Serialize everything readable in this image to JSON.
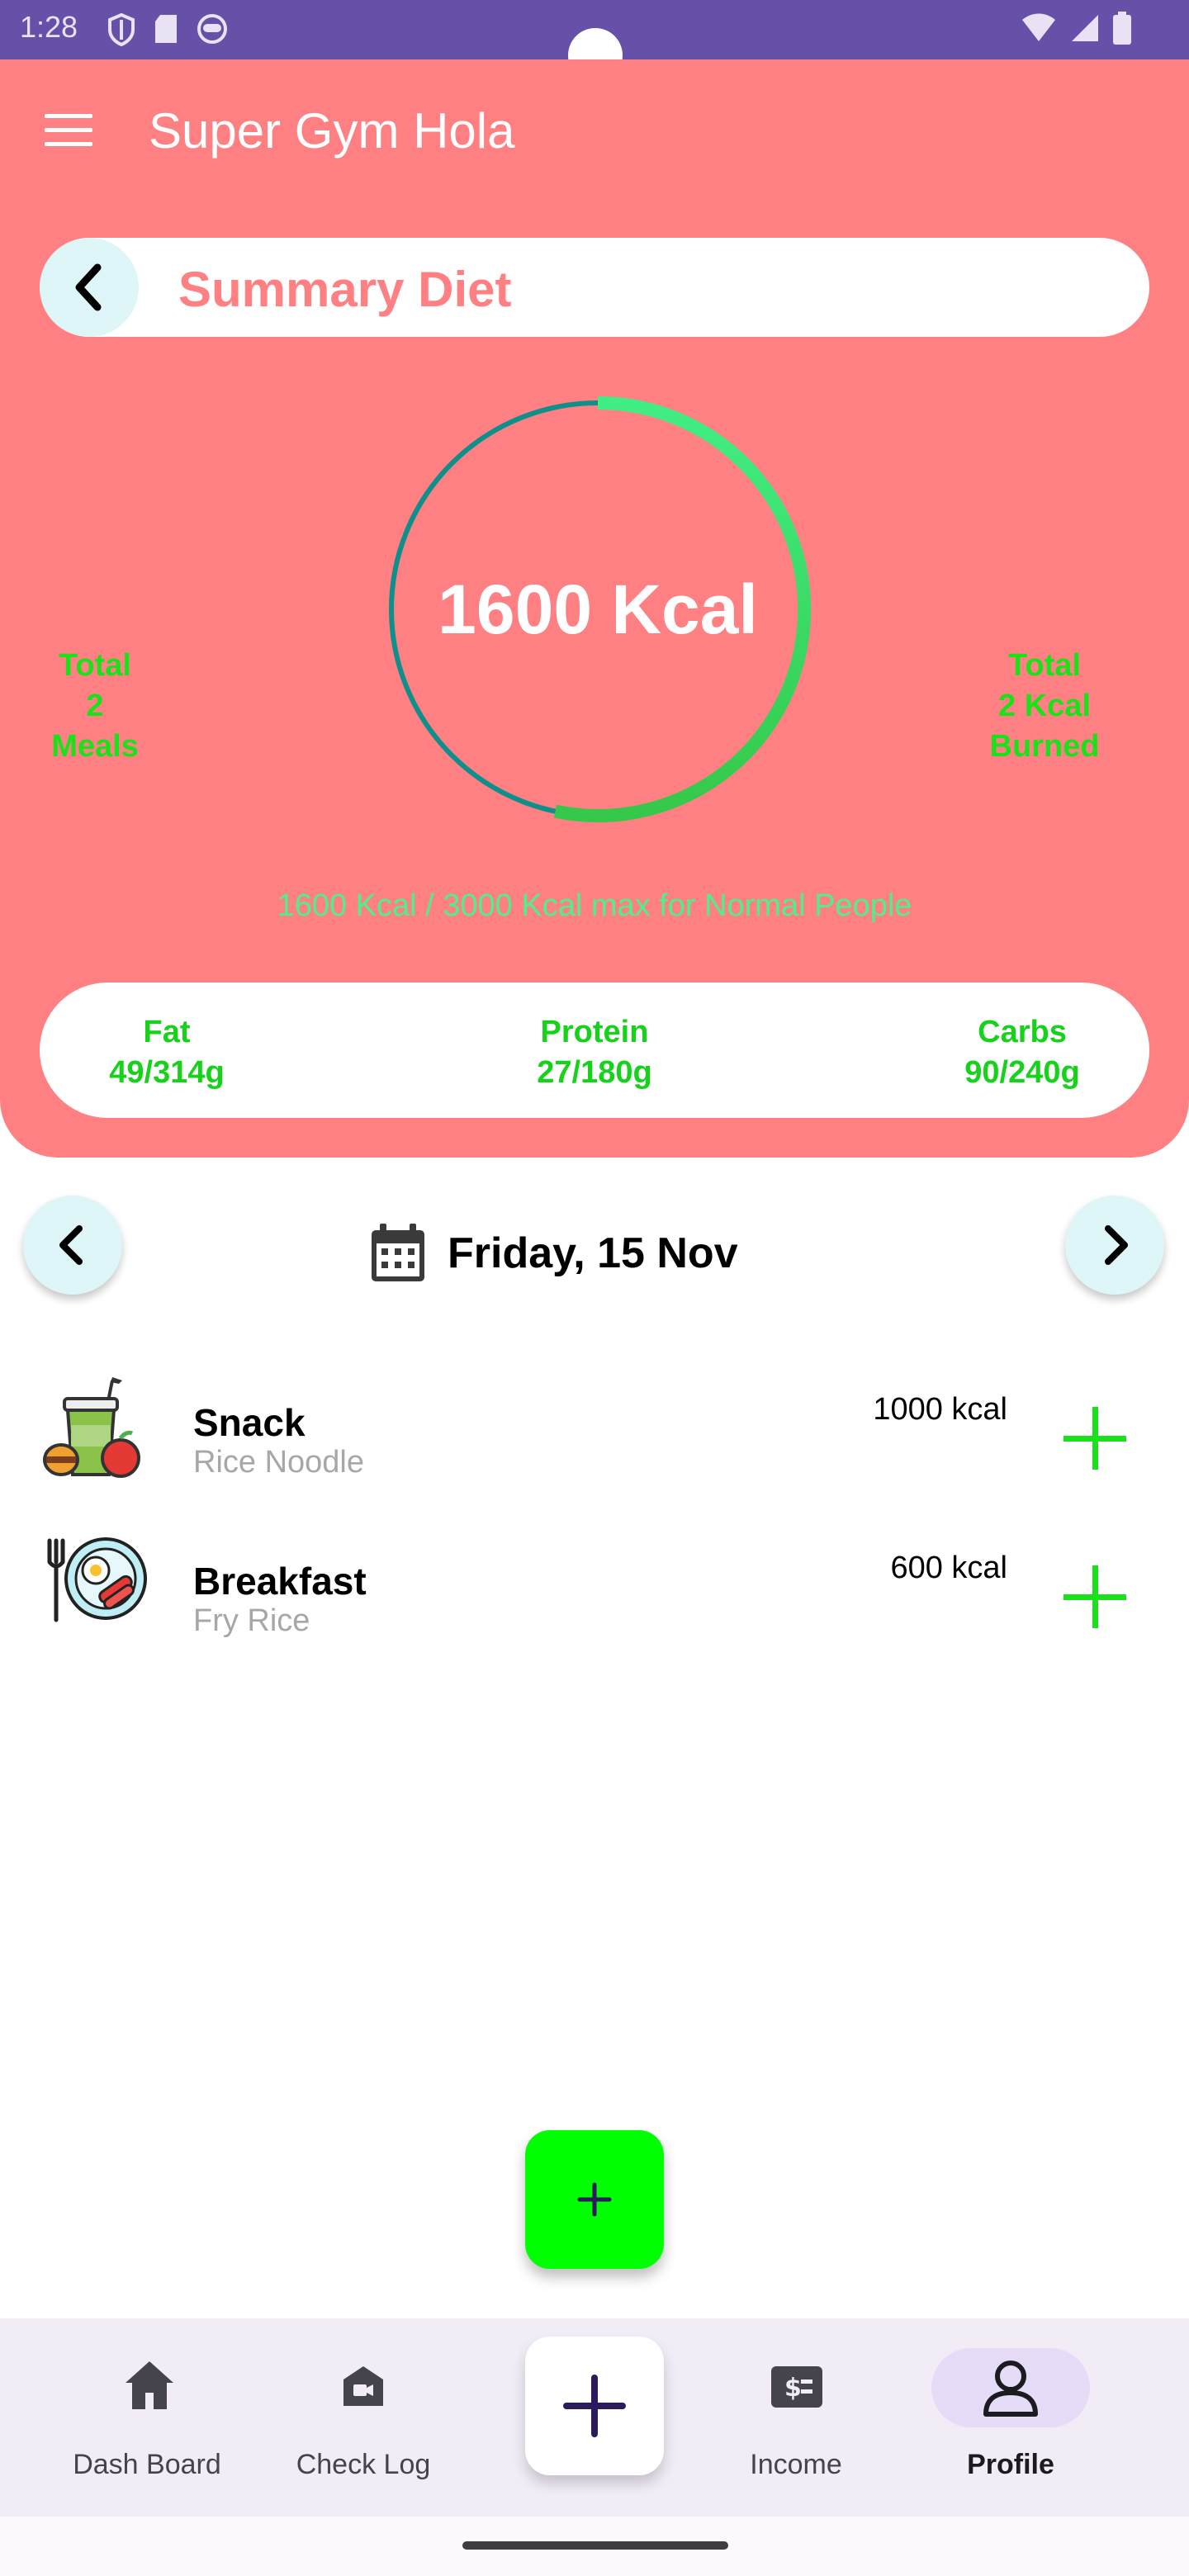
{
  "status_bar": {
    "time": "1:28",
    "left_icons": [
      "shield-icon",
      "sd-card-icon",
      "face-icon"
    ],
    "right_icons": [
      "wifi-icon",
      "signal-icon",
      "battery-icon"
    ]
  },
  "app_bar": {
    "title": "Super Gym Hola",
    "menu_icon": "hamburger-menu-icon"
  },
  "summary": {
    "title": "Summary Diet",
    "back_icon": "chevron-left-icon",
    "calories_label": "1600 Kcal",
    "calories_consumed": 1600,
    "calories_max": 3000,
    "progress_fraction": 0.533,
    "left_stat": [
      "Total",
      "2",
      "Meals"
    ],
    "right_stat": [
      "Total",
      "2 Kcal",
      "Burned"
    ],
    "max_note": "1600 Kcal / 3000 Kcal max for Normal People",
    "macros": [
      {
        "name": "Fat",
        "value": "49/314g"
      },
      {
        "name": "Protein",
        "value": "27/180g"
      },
      {
        "name": "Carbs",
        "value": "90/240g"
      }
    ]
  },
  "date_nav": {
    "date": "Friday, 15 Nov",
    "prev_icon": "chevron-left-icon",
    "next_icon": "chevron-right-icon",
    "calendar_icon": "calendar-icon"
  },
  "meals": [
    {
      "name": "Snack",
      "food": "Rice Noodle",
      "kcal": "1000 kcal",
      "icon": "snack-icon"
    },
    {
      "name": "Breakfast",
      "food": "Fry Rice",
      "kcal": "600 kcal",
      "icon": "breakfast-plate-icon"
    }
  ],
  "bottom_nav": {
    "items": [
      {
        "label": "Dash Board",
        "icon": "home-icon"
      },
      {
        "label": "Check Log",
        "icon": "video-house-icon"
      },
      {
        "label": "",
        "icon": "plus-icon"
      },
      {
        "label": "Income",
        "icon": "money-icon"
      },
      {
        "label": "Profile",
        "icon": "person-icon"
      }
    ],
    "active": "Profile"
  },
  "colors": {
    "header": "#fe8082",
    "status_bar": "#6750a8",
    "accent_green": "#00ff00",
    "macro_green": "#19e21a",
    "ring_start": "#0d8f8c",
    "ring_progress": "#3ee87c"
  }
}
